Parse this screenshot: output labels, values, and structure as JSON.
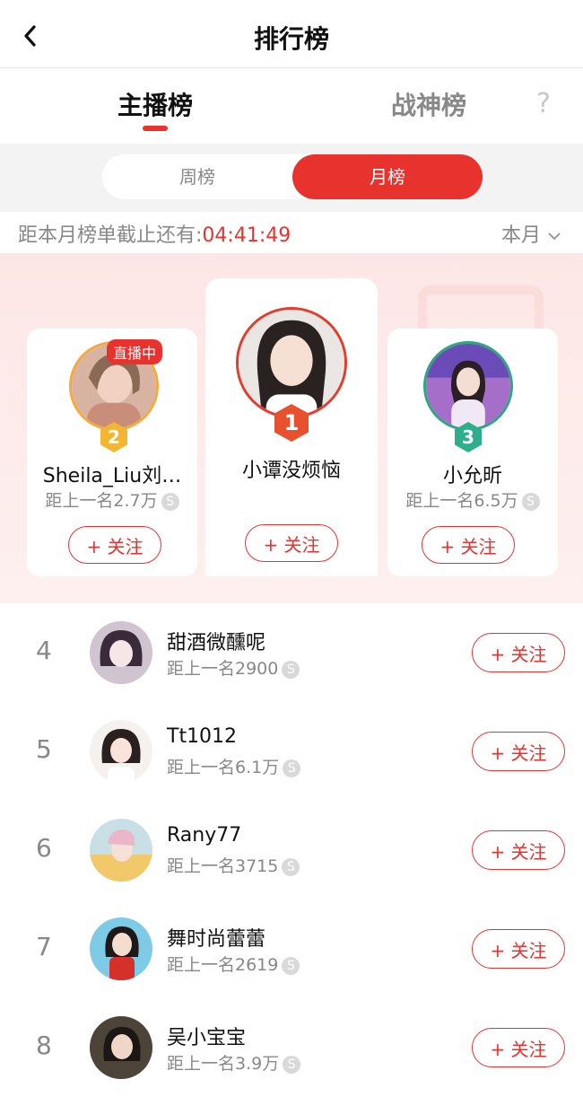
{
  "header": {
    "title": "排行榜",
    "back_icon": "chevron-left-icon"
  },
  "tabs": [
    {
      "label": "主播榜",
      "active": true
    },
    {
      "label": "战神榜",
      "active": false
    }
  ],
  "help_label": "?",
  "segments": {
    "week": "周榜",
    "month": "月榜",
    "active": "month"
  },
  "countdown": {
    "label": "距本月榜单截止还有:",
    "time": "04:41:49",
    "period": "本月"
  },
  "colors": {
    "accent": "#e8322e",
    "gold": "#f2b632",
    "green": "#2fae8c",
    "gray": "#888888"
  },
  "podium": {
    "first": {
      "rank": "1",
      "name": "小谭没烦恼",
      "follow": "+ 关注"
    },
    "second": {
      "rank": "2",
      "name": "Sheila_Liu刘…",
      "gap": "距上一名2.7万",
      "live": "直播中",
      "follow": "+ 关注"
    },
    "third": {
      "rank": "3",
      "name": "小允昕",
      "gap": "距上一名6.5万",
      "follow": "+ 关注"
    }
  },
  "coin_icon": "S",
  "list": [
    {
      "rank": "4",
      "name": "甜酒微醺呢",
      "gap": "距上一名2900",
      "follow": "+ 关注"
    },
    {
      "rank": "5",
      "name": "Tt1012",
      "gap": "距上一名6.1万",
      "follow": "+ 关注"
    },
    {
      "rank": "6",
      "name": "Rany77",
      "gap": "距上一名3715",
      "follow": "+ 关注"
    },
    {
      "rank": "7",
      "name": "舞时尚蕾蕾",
      "gap": "距上一名2619",
      "follow": "+ 关注"
    },
    {
      "rank": "8",
      "name": "吴小宝宝",
      "gap": "距上一名3.9万",
      "follow": "+ 关注"
    }
  ]
}
